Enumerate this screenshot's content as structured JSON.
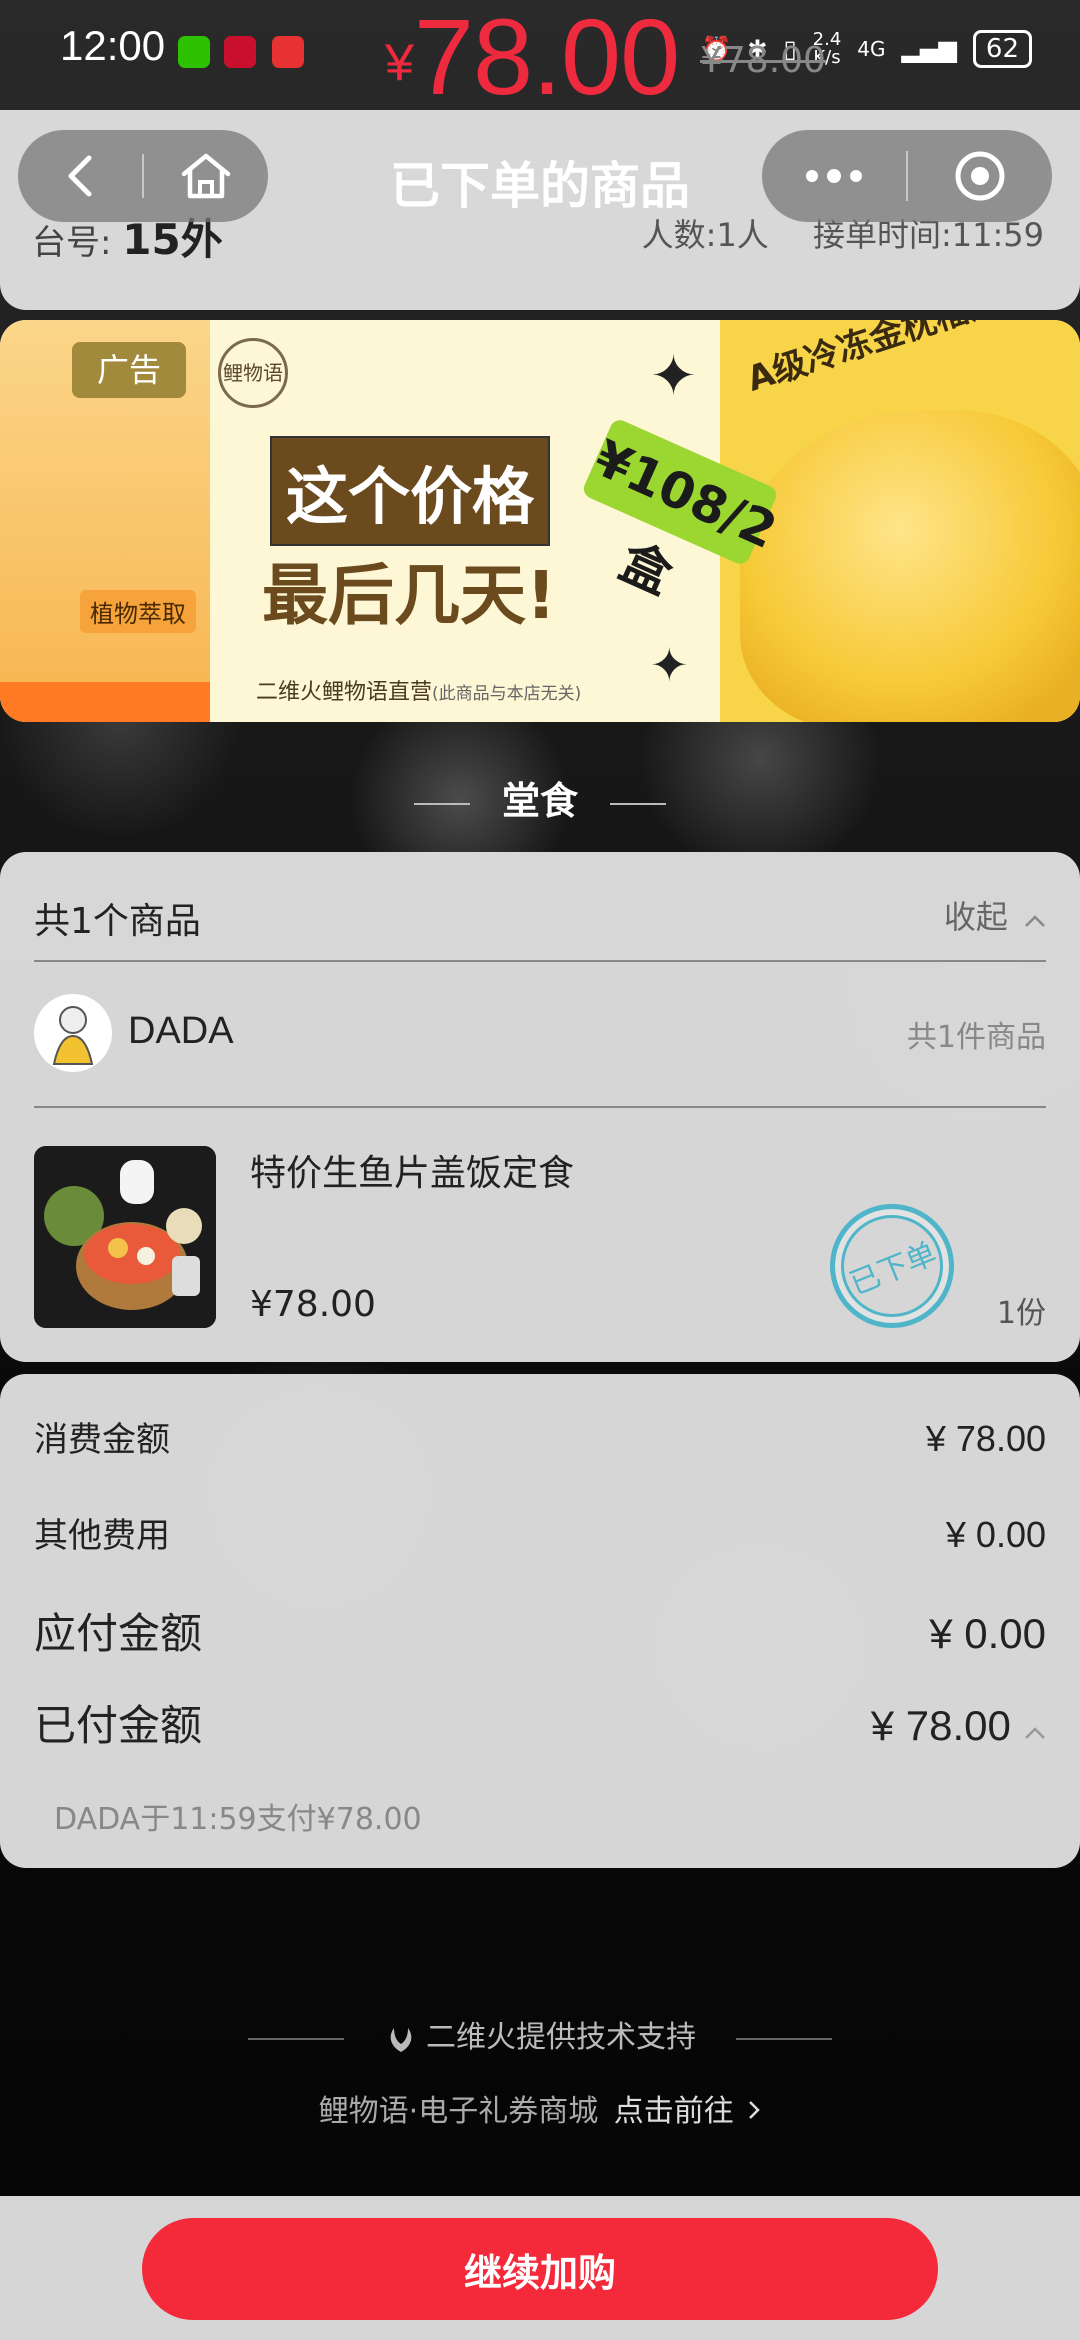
{
  "status_bar": {
    "time": "12:00",
    "net_speed_top": "2.4",
    "net_speed_bottom": "K/s",
    "network": "4G",
    "battery": "62"
  },
  "floating_price": {
    "currency": "¥",
    "amount": "78.00",
    "original": "¥78.00",
    "color": "#ee2a3e"
  },
  "nav": {
    "title": "已下单的商品",
    "back_icon": "chevron-left-icon",
    "home_icon": "home-icon",
    "more_icon": "more-dots-icon",
    "close_icon": "target-circle-icon"
  },
  "order_info": {
    "table_label": "台号:",
    "table_no": "15外",
    "people": "人数:1人",
    "order_time": "接单时间:11:59"
  },
  "ad": {
    "tag": "广告",
    "brand": "鲤物语",
    "plant_tag": "植物萃取",
    "headline1": "这个价格",
    "headline2": "最后几天!",
    "price_tag": "¥108/2盒",
    "product_title": "A级冷冻金枕榴莲肉",
    "footer": "二维火鲤物语直营",
    "footer_note": "(此商品与本店无关)"
  },
  "section": {
    "label": "堂食"
  },
  "products": {
    "count_label": "共1个商品",
    "collapse_label": "收起",
    "shop_name": "DADA",
    "shop_count": "共1件商品",
    "items": [
      {
        "name": "特价生鱼片盖饭定食",
        "price": "¥78.00",
        "qty": "1份",
        "stamp": "已下单"
      }
    ]
  },
  "totals": {
    "consume_label": "消费金额",
    "consume_value": "¥ 78.00",
    "other_label": "其他费用",
    "other_value": "¥ 0.00",
    "payable_label": "应付金额",
    "payable_value": "¥ 0.00",
    "paid_label": "已付金额",
    "paid_value": "¥ 78.00",
    "paid_note": "DADA于11:59支付¥78.00"
  },
  "footer": {
    "support": "二维火提供技术支持",
    "mall": "鲤物语·电子礼券商城",
    "mall_go": "点击前往",
    "button": "继续加购",
    "button_color": "#f42a3a"
  }
}
